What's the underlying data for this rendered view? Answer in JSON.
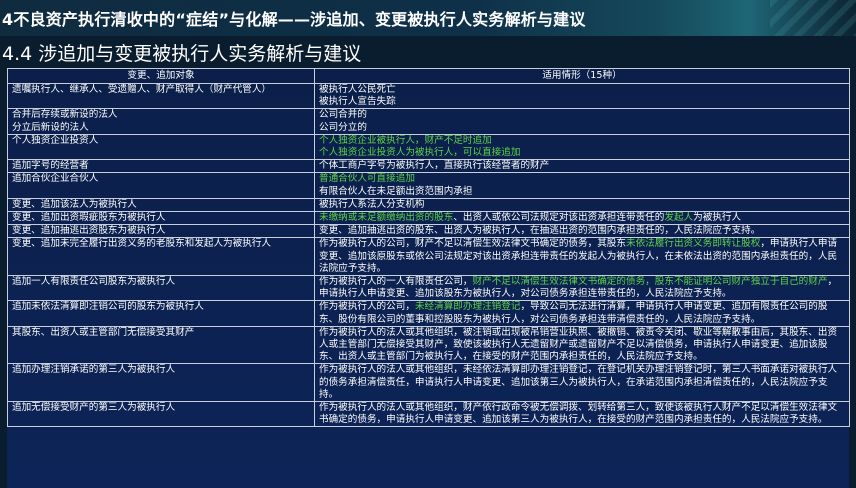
{
  "slide": {
    "title": "4不良资产执行清收中的“症结”与化解——涉追加、变更被执行人实务解析与建议",
    "section_heading": "4.4 涉追加与变更被执行人实务解析与建议"
  },
  "table": {
    "header_col1": "变更、追加对象",
    "header_col2": "适用情形（15种）",
    "rows": [
      {
        "object": [
          "遗嘱执行人、继承人、受遗赠人、财产取得人（财产代管人）"
        ],
        "cases": [
          {
            "t": "被执行人公民死亡"
          },
          {
            "t": "被执行人宣告失踪"
          }
        ]
      },
      {
        "object": [
          "合并后存续或新设的法人",
          "分立后新设的法人"
        ],
        "cases": [
          {
            "t": "公司合并的"
          },
          {
            "t": "公司分立的"
          }
        ]
      },
      {
        "object": [
          "个人独资企业投资人"
        ],
        "cases": [
          {
            "t": "个人独资企业被执行人，财产不足时追加",
            "green": true
          },
          {
            "t": "个人独资企业投资人为被执行人，可以直接追加",
            "green": true
          }
        ]
      },
      {
        "object": [
          "追加字号的经营者"
        ],
        "cases": [
          {
            "t": "个体工商户字号为被执行人，直接执行该经营者的财产"
          }
        ]
      },
      {
        "object": [
          "追加合伙企业合伙人"
        ],
        "cases": [
          {
            "t": "普通合伙人可直接追加",
            "green": true
          },
          {
            "t": "有限合伙人在未足额出资范围内承担"
          }
        ]
      },
      {
        "object": [
          "变更、追加该法人为被执行人"
        ],
        "cases": [
          {
            "t": "被执行人系法人分支机构"
          }
        ]
      },
      {
        "object": [
          "变更、追加出资瑕疵股东为被执行人"
        ],
        "cases": [
          {
            "segs": [
              {
                "t": "未缴纳或未足额缴纳出资的股东",
                "green": true
              },
              {
                "t": "、出资人或依公司法规定对该出资承担连带责任的"
              },
              {
                "t": "发起人",
                "green": true
              },
              {
                "t": "为被执行人"
              }
            ]
          }
        ]
      },
      {
        "object": [
          "变更、追加抽逃出资股东为被执行人"
        ],
        "cases": [
          {
            "t": "变更、追加抽逃出资的股东、出资人为被执行人，在抽逃出资的范围内承担责任的，人民法院应予支持。"
          }
        ]
      },
      {
        "object": [
          "变更、追加未完全履行出资义务的老股东和发起人为被执行人"
        ],
        "cases": [
          {
            "segs": [
              {
                "t": "作为被执行人的公司，财产不足以清偿生效法律文书确定的债务，其股东"
              },
              {
                "t": "未依法履行出资义务即转让股权",
                "green": true
              },
              {
                "t": "，申请执行人申请变更、追加该原股东或依公司法规定对该出资承担连带责任的发起人为被执行人，在未依法出资的范围内承担责任的，人民法院应予支持。"
              }
            ]
          }
        ]
      },
      {
        "object": [
          "追加一人有限责任公司股东为被执行人"
        ],
        "cases": [
          {
            "segs": [
              {
                "t": "作为被执行人的一人有限责任公司，"
              },
              {
                "t": "财产不足以清偿生效法律文书确定的债务，股东不能证明公司财产独立于自己的财产",
                "green": true
              },
              {
                "t": "，申请执行人申请变更、追加该股东为被执行人，对公司债务承担连带责任的，人民法院应予支持。"
              }
            ]
          }
        ]
      },
      {
        "object": [
          "追加未依法清算即注销公司的股东为被执行人"
        ],
        "cases": [
          {
            "segs": [
              {
                "t": "作为被执行人的公司，"
              },
              {
                "t": "未经清算即办理注销登记",
                "green": true
              },
              {
                "t": "，导致公司无法进行清算，申请执行人申请变更、追加有限责任公司的股东、股份有限公司的董事和控股股东为被执行人，对公司债务承担连带清偿责任的，人民法院应予支持。"
              }
            ]
          }
        ]
      },
      {
        "object": [
          "其股东、出资人或主管部门无偿接受其财产"
        ],
        "cases": [
          {
            "t": "作为被执行人的法人或其他组织，被注销或出现被吊销营业执照、被撤销、被责令关闭、歇业等解散事由后，其股东、出资人或主管部门无偿接受其财产，致使该被执行人无遗留财产或遗留财产不足以清偿债务，申请执行人申请变更、追加该股东、出资人或主管部门为被执行人，在接受的财产范围内承担责任的，人民法院应予支持。"
          }
        ]
      },
      {
        "object": [
          "追加办理注销承诺的第三人为被执行人"
        ],
        "cases": [
          {
            "t": "作为被执行人的法人或其他组织，未经依法清算即办理注销登记，在登记机关办理注销登记时，第三人书面承诺对被执行人的债务承担清偿责任，申请执行人申请变更、追加该第三人为被执行人，在承诺范围内承担清偿责任的，人民法院应予支持。"
          }
        ]
      },
      {
        "object": [
          "追加无偿接受财产的第三人为被执行人"
        ],
        "cases": [
          {
            "t": "作为被执行人的法人或其他组织，财产依行政命令被无偿调拨、划转给第三人，致使该被执行人财产不足以清偿生效法律文书确定的债务，申请执行人申请变更、追加该第三人为被执行人，在接受的财产范围内承担责任的，人民法院应予支持。"
          }
        ]
      }
    ]
  },
  "colors": {
    "background": "#0a1d2e",
    "table_fill": "#0b1f4a",
    "highlight_text": "#5fd34a",
    "border": "#c9cfda"
  }
}
